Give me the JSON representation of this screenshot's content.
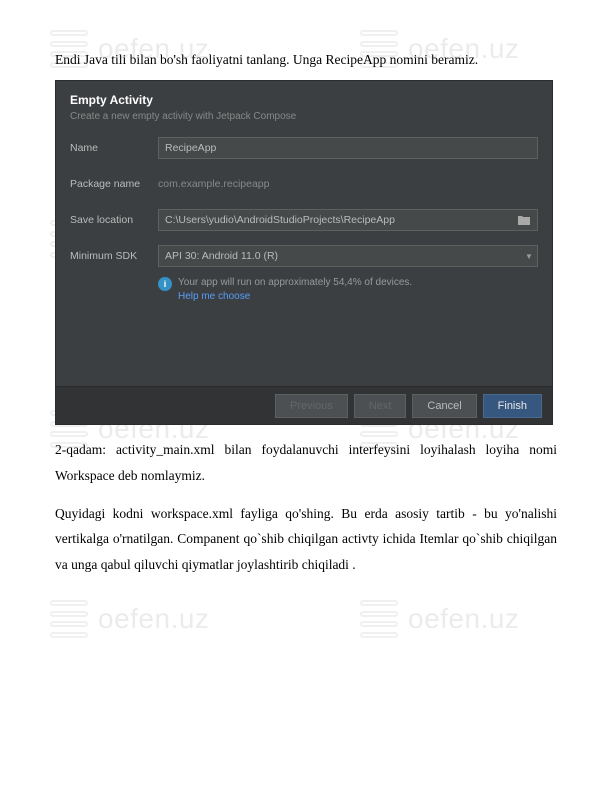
{
  "watermark": "oefen.uz",
  "intro": "Endi Java tili bilan bo'sh faoliyatni tanlang. Unga RecipeApp nomini beramiz.",
  "dialog": {
    "title": "Empty Activity",
    "subtitle": "Create a new empty activity with Jetpack Compose",
    "fields": {
      "name_label": "Name",
      "name_value": "RecipeApp",
      "package_label": "Package name",
      "package_value": "com.example.recipeapp",
      "save_label": "Save location",
      "save_value": "C:\\Users\\yudio\\AndroidStudioProjects\\RecipeApp",
      "sdk_label": "Minimum SDK",
      "sdk_value": "API 30: Android 11.0 (R)"
    },
    "info": {
      "text": "Your app will run on approximately 54,4% of devices.",
      "link": "Help me choose"
    },
    "buttons": {
      "previous": "Previous",
      "next": "Next",
      "cancel": "Cancel",
      "finish": "Finish"
    }
  },
  "body": {
    "p1": "2-qadam: activity_main.xml bilan foydalanuvchi interfeysini loyihalash loyiha nomi Workspace deb nomlaymiz.",
    "p2": "Quyidagi kodni workspace.xml fayliga qo'shing. Bu erda asosiy tartib - bu yo'nalishi vertikalga o'rnatilgan. Companent  qo`shib chiqilgan  activty ichida Itemlar qo`shib chiqilgan  va unga qabul qiluvchi qiymatlar joylashtirib chiqiladi ."
  }
}
